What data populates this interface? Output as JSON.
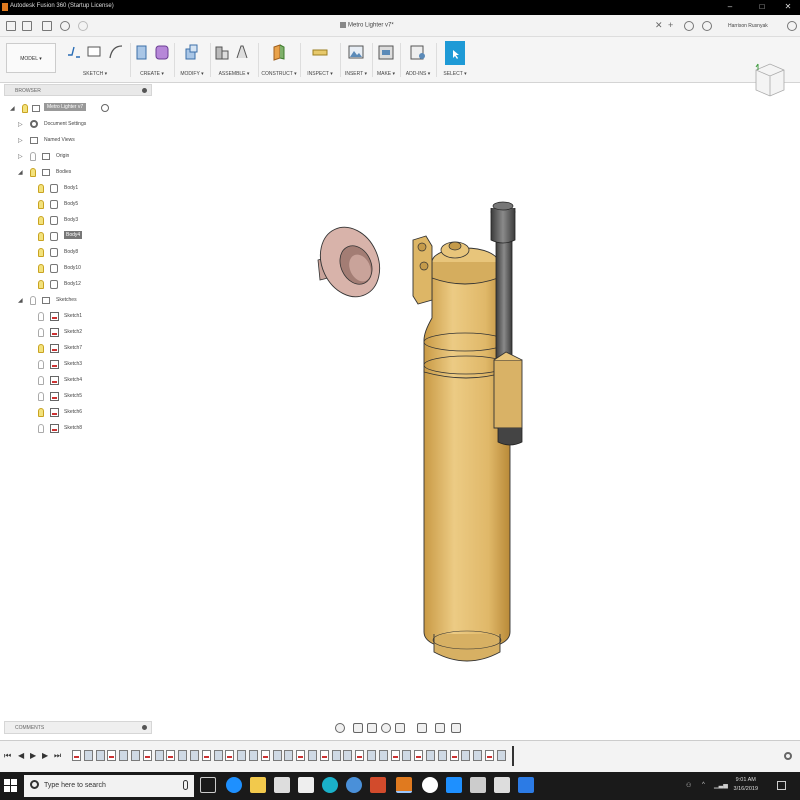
{
  "window": {
    "title": "Autodesk Fusion 360 (Startup License)",
    "min_glyph": "–",
    "max_glyph": "□",
    "close_glyph": "✕"
  },
  "document": {
    "tab_title": "Metro Lighter v7*",
    "user": "Harrison Rusnyak"
  },
  "ribbon": {
    "workspace": "MODEL ▾",
    "groups": [
      {
        "id": "sketch",
        "label": "SKETCH ▾"
      },
      {
        "id": "create",
        "label": "CREATE ▾"
      },
      {
        "id": "modify",
        "label": "MODIFY ▾"
      },
      {
        "id": "assemble",
        "label": "ASSEMBLE ▾"
      },
      {
        "id": "construct",
        "label": "CONSTRUCT ▾"
      },
      {
        "id": "inspect",
        "label": "INSPECT ▾"
      },
      {
        "id": "insert",
        "label": "INSERT ▾"
      },
      {
        "id": "make",
        "label": "MAKE ▾"
      },
      {
        "id": "addins",
        "label": "ADD-INS ▾"
      },
      {
        "id": "select",
        "label": "SELECT ▾"
      }
    ]
  },
  "browser": {
    "header": "BROWSER",
    "root": "Metro Lighter v7",
    "document_settings": "Document Settings",
    "named_views": "Named Views",
    "origin": "Origin",
    "bodies_folder": "Bodies",
    "bodies": [
      {
        "label": "Body1",
        "selected": false
      },
      {
        "label": "Body5",
        "selected": false
      },
      {
        "label": "Body3",
        "selected": false
      },
      {
        "label": "Body4",
        "selected": true
      },
      {
        "label": "Body8",
        "selected": false
      },
      {
        "label": "Body10",
        "selected": false
      },
      {
        "label": "Body12",
        "selected": false
      }
    ],
    "sketches_folder": "Sketches",
    "sketches": [
      "Sketch1",
      "Sketch2",
      "Sketch7",
      "Sketch3",
      "Sketch4",
      "Sketch5",
      "Sketch6",
      "Sketch8"
    ]
  },
  "comments": {
    "header": "COMMENTS"
  },
  "taskbar": {
    "search_placeholder": "Type here to search",
    "time": "9:01 AM",
    "date": "3/16/2019"
  },
  "colors": {
    "lighter_body": "#e2bc6b",
    "lighter_shadow": "#c49a4a",
    "wheel": "#cfa9a0",
    "selection": "#0696d7"
  }
}
